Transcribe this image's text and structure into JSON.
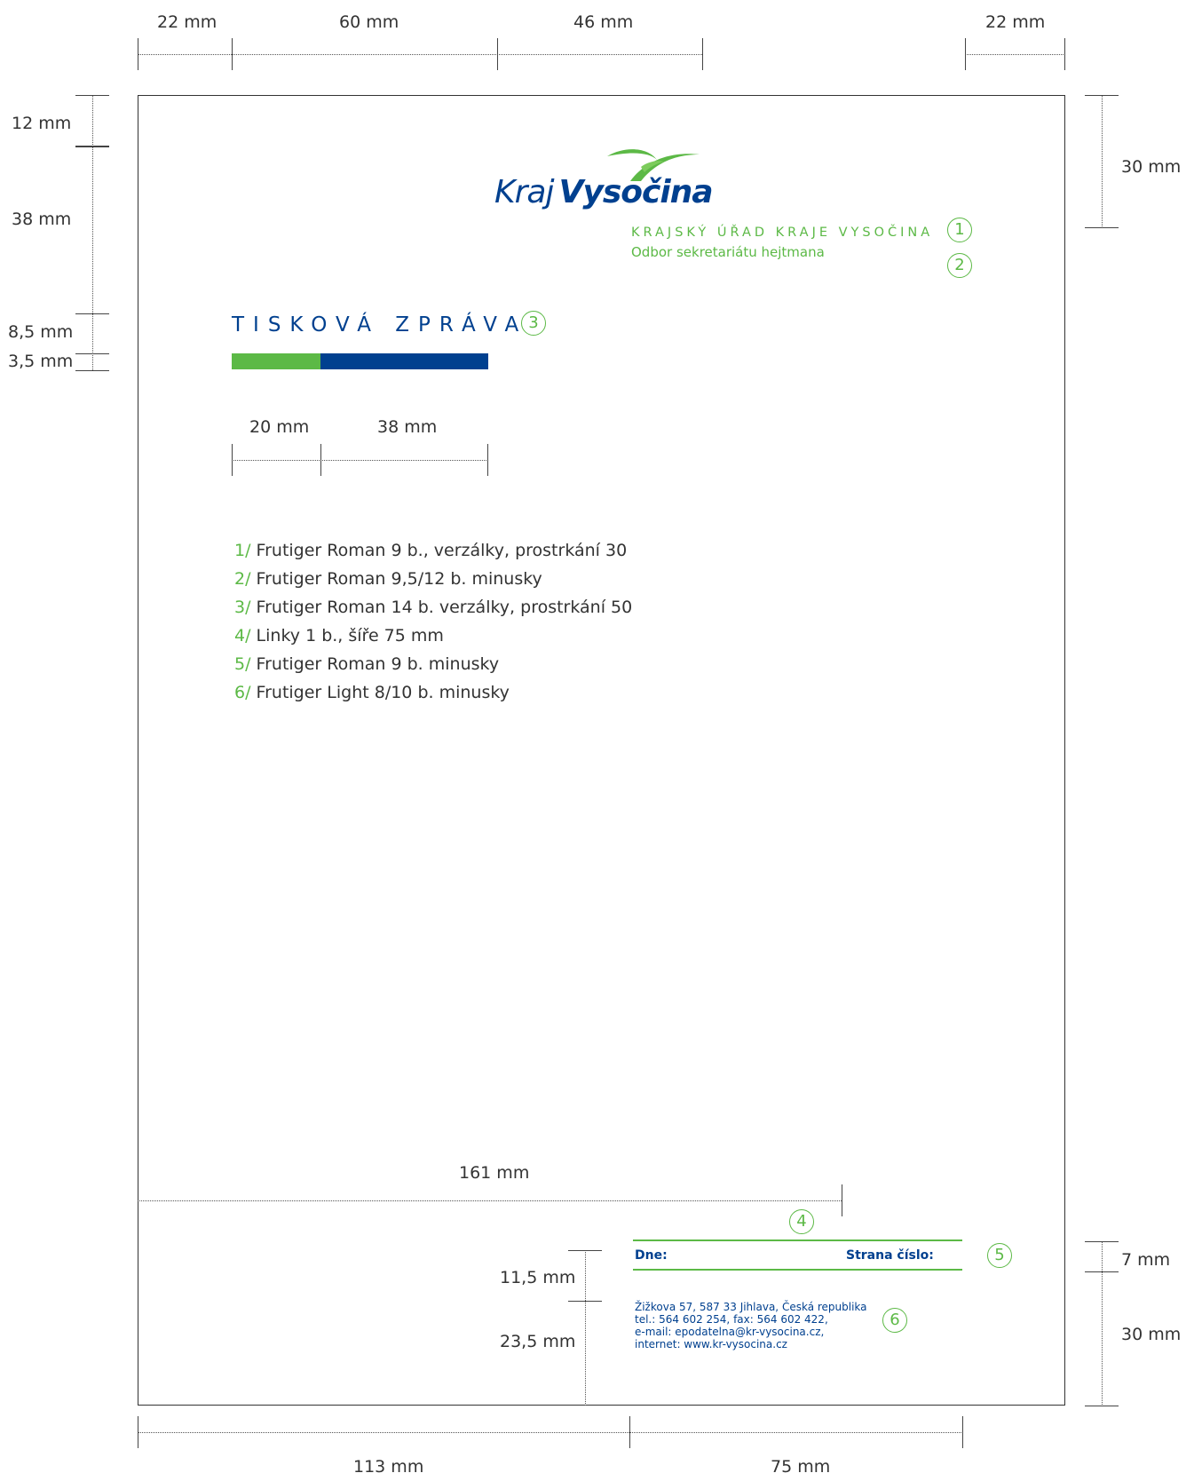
{
  "dims": {
    "top": [
      "22 mm",
      "60 mm",
      "46 mm",
      "22 mm"
    ],
    "left": [
      "12 mm",
      "38 mm",
      "8,5 mm",
      "3,5 mm"
    ],
    "right_top": "30 mm",
    "bar_widths": [
      "20 mm",
      "38 mm"
    ],
    "footer_line": "161 mm",
    "footer_left": [
      "11,5 mm",
      "23,5 mm"
    ],
    "right_bottom": [
      "7 mm",
      "30 mm"
    ],
    "bottom": [
      "113 mm",
      "75 mm"
    ]
  },
  "logo": {
    "kraj": "Kraj",
    "vysocina": "Vysočina"
  },
  "header": {
    "office": "KRAJSKÝ ÚŘAD KRAJE VYSOČINA",
    "department": "Odbor sekretariátu hejtmana"
  },
  "title": "TISKOVÁ ZPRÁVA",
  "markers": [
    "1",
    "2",
    "3",
    "4",
    "5",
    "6"
  ],
  "specs": [
    {
      "num": "1/",
      "text": "Frutiger Roman 9 b., verzálky, prostrkání 30"
    },
    {
      "num": "2/",
      "text": "Frutiger Roman 9,5/12 b. minusky"
    },
    {
      "num": "3/",
      "text": "Frutiger Roman 14 b. verzálky, prostrkání 50"
    },
    {
      "num": "4/",
      "text": "Linky 1 b., šíře 75 mm"
    },
    {
      "num": "5/",
      "text": "Frutiger Roman 9 b. minusky"
    },
    {
      "num": "6/",
      "text": "Frutiger Light 8/10 b. minusky"
    }
  ],
  "footer": {
    "date_label": "Dne:",
    "page_label": "Strana číslo:",
    "address": [
      "Žižkova 57, 587 33 Jihlava, Česká republika",
      "tel.: 564 602 254, fax: 564 602 422,",
      "e-mail: epodatelna@kr-vysocina.cz,",
      "internet: www.kr-vysocina.cz"
    ]
  },
  "colors": {
    "green": "#5cb946",
    "blue": "#00408f"
  }
}
